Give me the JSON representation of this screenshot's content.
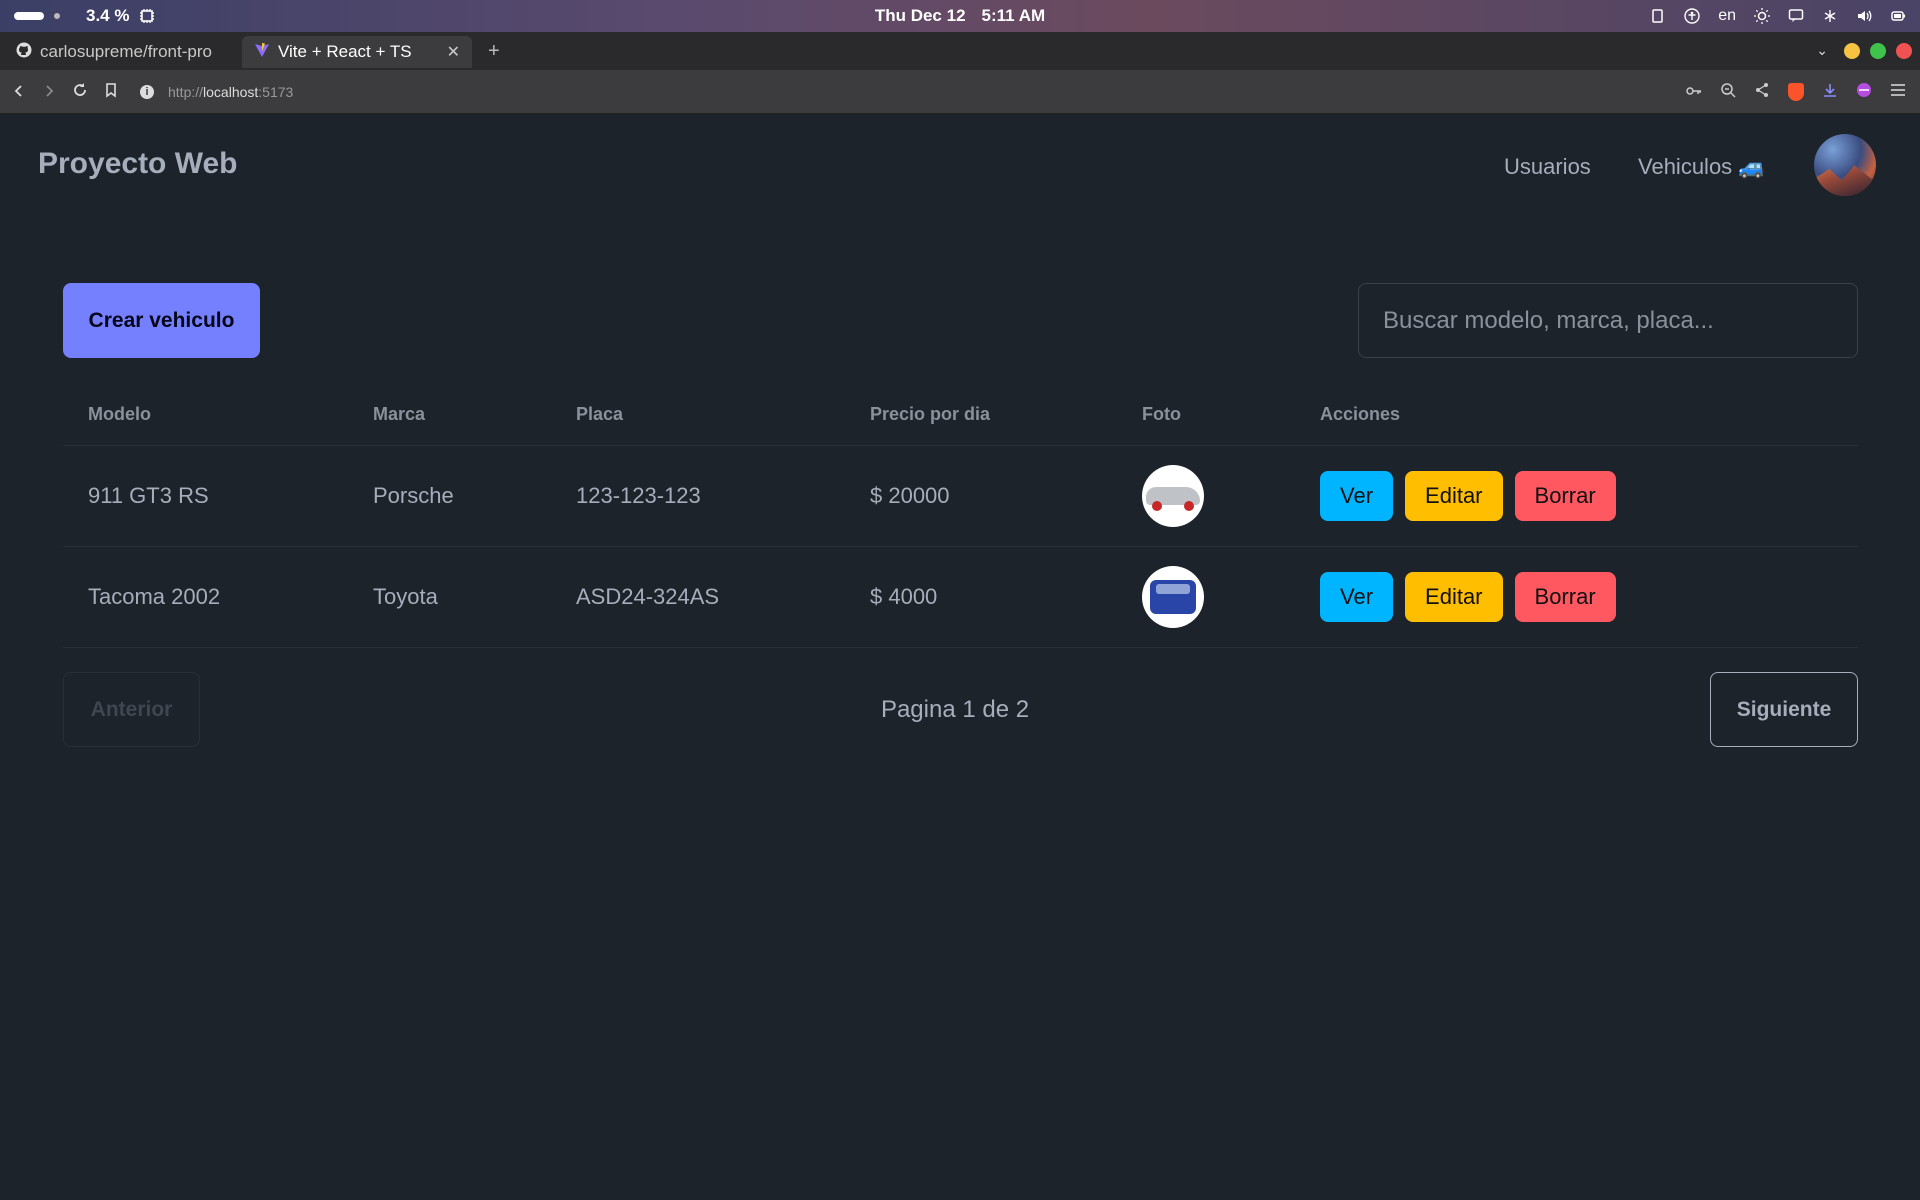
{
  "system": {
    "cpu": "3.4 %",
    "date": "Thu Dec 12",
    "time": "5:11 AM",
    "lang": "en"
  },
  "browser": {
    "tabs": [
      {
        "title": "carlosupreme/front-pro",
        "icon": "github-icon"
      },
      {
        "title": "Vite + React + TS",
        "icon": "vite-icon"
      }
    ],
    "url_prefix": "http://",
    "url_host": "localhost",
    "url_port": ":5173"
  },
  "app": {
    "brand": "Proyecto Web",
    "nav": {
      "users": "Usuarios",
      "vehicles": "Vehiculos 🚙"
    },
    "create_label": "Crear vehiculo",
    "search_placeholder": "Buscar modelo, marca, placa...",
    "columns": [
      "Modelo",
      "Marca",
      "Placa",
      "Precio por dia",
      "Foto",
      "Acciones"
    ],
    "rows": [
      {
        "model": "911 GT3 RS",
        "brand": "Porsche",
        "plate": "123-123-123",
        "price": "$ 20000"
      },
      {
        "model": "Tacoma 2002",
        "brand": "Toyota",
        "plate": "ASD24-324AS",
        "price": "$ 4000"
      }
    ],
    "actions": {
      "view": "Ver",
      "edit": "Editar",
      "delete": "Borrar"
    },
    "pagination": {
      "prev": "Anterior",
      "info": "Pagina 1 de 2",
      "next": "Siguiente"
    },
    "colors": {
      "primary": "#7480ff",
      "info": "#00b5ff",
      "warning": "#ffbe00",
      "error": "#ff5861",
      "bg": "#1d232a"
    }
  }
}
